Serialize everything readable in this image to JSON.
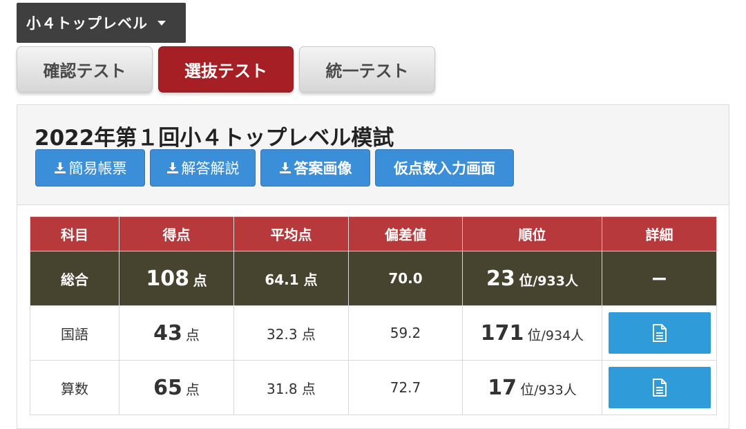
{
  "level_selector": {
    "label": "小４トップレベル"
  },
  "tabs": [
    {
      "label": "確認テスト"
    },
    {
      "label": "選抜テスト"
    },
    {
      "label": "統一テスト"
    }
  ],
  "exam": {
    "title": "2022年第１回小４トップレベル模試",
    "actions": [
      "簡易帳票",
      "解答解説",
      "答案画像",
      "仮点数入力画面"
    ]
  },
  "table": {
    "headers": [
      "科目",
      "得点",
      "平均点",
      "偏差値",
      "順位",
      "詳細"
    ],
    "rows": [
      {
        "subject": "総合",
        "score": "108",
        "score_unit": "点",
        "average": "64.1 点",
        "deviation": "70.0",
        "rank": "23",
        "rank_unit": "位",
        "rank_total": "/933人",
        "detail": "−"
      },
      {
        "subject": "国語",
        "score": "43",
        "score_unit": "点",
        "average": "32.3 点",
        "deviation": "59.2",
        "rank": "171",
        "rank_unit": "位",
        "rank_total": "/934人",
        "detail_icon": "document-icon"
      },
      {
        "subject": "算数",
        "score": "65",
        "score_unit": "点",
        "average": "31.8 点",
        "deviation": "72.7",
        "rank": "17",
        "rank_unit": "位",
        "rank_total": "/933人",
        "detail_icon": "document-icon"
      }
    ]
  },
  "colors": {
    "active_tab": "#a61f24",
    "header_row": "#b8393c",
    "total_row": "#46432f",
    "action_button": "#3a8fd8",
    "detail_button": "#2f9bd8"
  }
}
